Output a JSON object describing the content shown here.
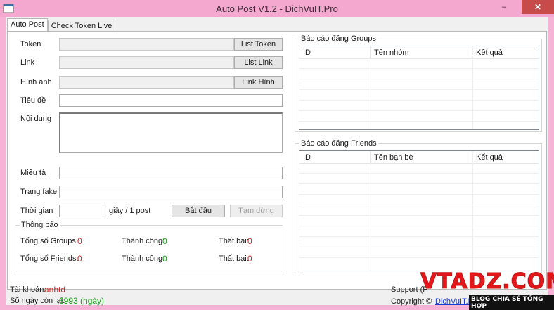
{
  "window": {
    "title": "Auto Post V1.2 - DichVuIT.Pro",
    "controls": {
      "minimize": "–",
      "close": "✕"
    }
  },
  "tabs": [
    {
      "label": "Auto Post",
      "active": true
    },
    {
      "label": "Check Token Live",
      "active": false
    }
  ],
  "form": {
    "token_label": "Token",
    "token_value": "",
    "list_token_button": "List Token",
    "link_label": "Link",
    "link_value": "",
    "list_link_button": "List Link",
    "image_label": "Hình ảnh",
    "image_value": "",
    "link_image_button": "Link Hình",
    "title_label": "Tiêu đề",
    "title_value": "",
    "content_label": "Nội dung",
    "content_value": "",
    "description_label": "Miêu tả",
    "description_value": "",
    "fake_page_label": "Trang fake",
    "fake_page_value": "",
    "time_label": "Thời gian",
    "time_value": "",
    "time_unit": "giây / 1 post",
    "start_button": "Bắt đầu",
    "pause_button": "Tạm dừng"
  },
  "notice": {
    "title": "Thông báo",
    "groups_total_label": "Tổng số Groups:",
    "groups_total": "0",
    "groups_success_label": "Thành công:",
    "groups_success": "0",
    "groups_fail_label": "Thất bại:",
    "groups_fail": "0",
    "friends_total_label": "Tổng số Friends:",
    "friends_total": "0",
    "friends_success_label": "Thành công:",
    "friends_success": "0",
    "friends_fail_label": "Thất bại:",
    "friends_fail": "0"
  },
  "groups_report": {
    "title": "Báo cáo đăng Groups",
    "columns": [
      "ID",
      "Tên nhóm",
      "Kết quả"
    ],
    "rows": []
  },
  "friends_report": {
    "title": "Báo cáo đăng Friends",
    "columns": [
      "ID",
      "Tên bạn bè",
      "Kết quả"
    ],
    "rows": []
  },
  "status": {
    "account_label": "Tài khoản:",
    "account_value": "anhtd",
    "days_left_label": "Số ngày còn lại:",
    "days_left_value": "6993 (ngày)",
    "support_text": "Support (F",
    "copyright_text": "Copyright ©",
    "copyright_link": "DichVuIT.Pro"
  },
  "watermark": {
    "brand": "VTADZ.COM",
    "tagline": "BLOG CHIA SẺ TỔNG HỢP"
  },
  "colors": {
    "title_bar": "#f5a8cf",
    "close_button": "#c74b4b",
    "count_red": "#e02020",
    "count_green": "#1e9e1e",
    "account_red": "#e02020",
    "days_green": "#1e9e1e",
    "link_blue": "#1a3cc7",
    "brand_red": "#e3171b"
  }
}
